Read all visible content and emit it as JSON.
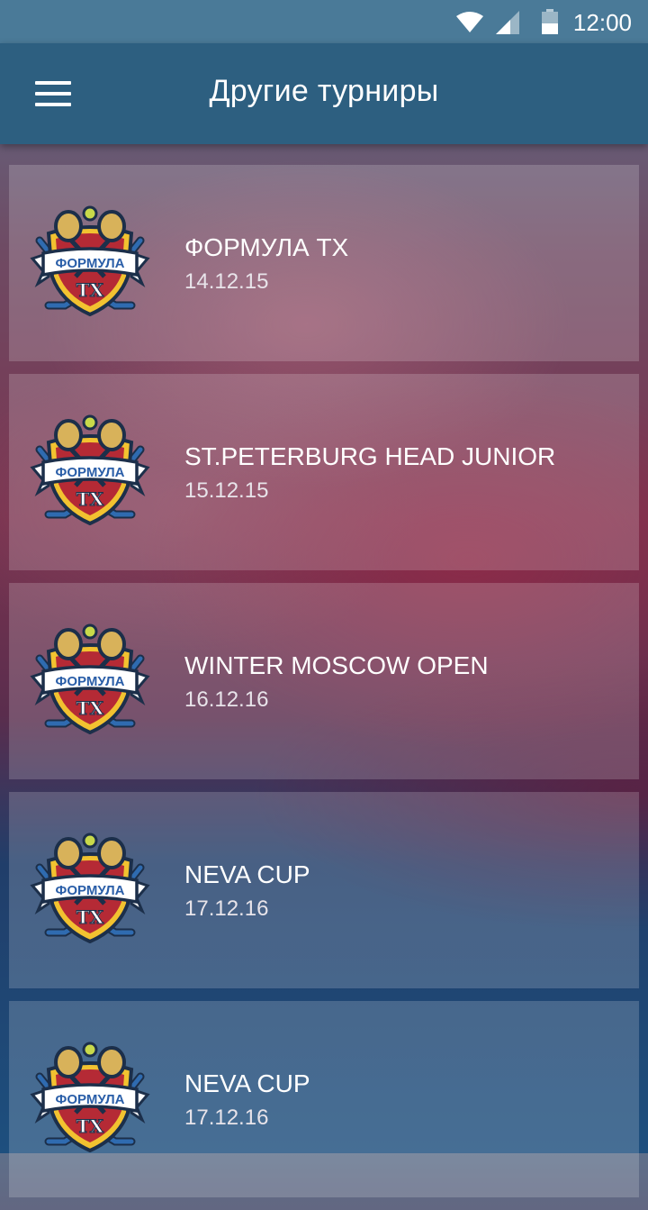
{
  "status_bar": {
    "time": "12:00"
  },
  "app_bar": {
    "title": "Другие турниры"
  },
  "logo": {
    "top_text": "ФОРМУЛА",
    "bottom_text": "ТХ"
  },
  "tournaments": [
    {
      "name": "ФОРМУЛА ТХ",
      "date": "14.12.15"
    },
    {
      "name": "ST.PETERBURG HEAD JUNIOR",
      "date": "15.12.15"
    },
    {
      "name": "WINTER MOSCOW OPEN",
      "date": "16.12.16"
    },
    {
      "name": "NEVA CUP",
      "date": "17.12.16"
    },
    {
      "name": "NEVA CUP",
      "date": "17.12.16"
    }
  ],
  "colors": {
    "app_bar": "#2d5f80",
    "status_bar": "#4a7a98",
    "shield_red": "#b52a35",
    "shield_yellow": "#f2c230",
    "banner_blue": "#2a5ea8"
  }
}
